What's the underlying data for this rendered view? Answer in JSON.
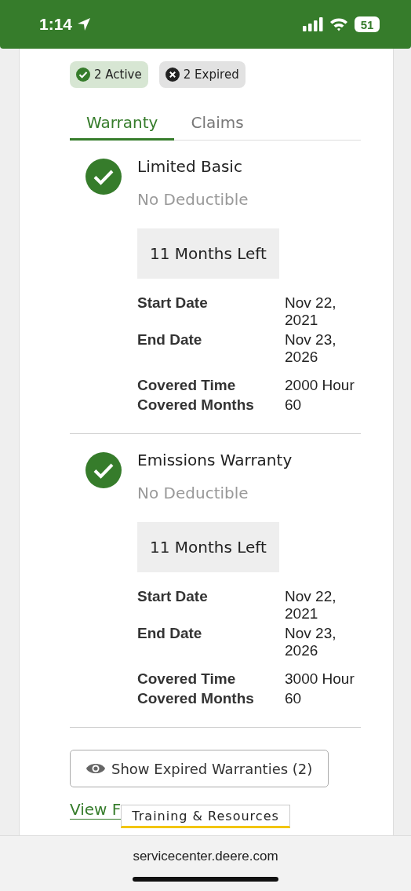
{
  "status_bar": {
    "time": "1:14",
    "battery": "51"
  },
  "chips": [
    {
      "kind": "active",
      "label": "2 Active"
    },
    {
      "kind": "expired",
      "label": "2 Expired"
    }
  ],
  "tabs": [
    {
      "label": "Warranty",
      "selected": true
    },
    {
      "label": "Claims",
      "selected": false
    }
  ],
  "warranties": [
    {
      "name": "Limited Basic",
      "deductible": "No Deductible",
      "remaining": "11  Months Left",
      "groups": [
        [
          {
            "label": "Start Date",
            "value": "Nov 22, 2021"
          },
          {
            "label": "End Date",
            "value": "Nov 23, 2026"
          }
        ],
        [
          {
            "label": "Covered Time",
            "value": "2000 Hour"
          },
          {
            "label": "Covered Months",
            "value": "60"
          }
        ]
      ]
    },
    {
      "name": "Emissions Warranty",
      "deductible": "No Deductible",
      "remaining": "11  Months Left",
      "groups": [
        [
          {
            "label": "Start Date",
            "value": "Nov 22, 2021"
          },
          {
            "label": "End Date",
            "value": "Nov 23, 2026"
          }
        ],
        [
          {
            "label": "Covered Time",
            "value": "3000 Hour"
          },
          {
            "label": "Covered Months",
            "value": "60"
          }
        ]
      ]
    }
  ],
  "expired_button": "Show Expired Warranties (2)",
  "details_link": "View F",
  "tooltip": "Training & Resources",
  "browser": {
    "url": "servicecenter.deere.com"
  }
}
